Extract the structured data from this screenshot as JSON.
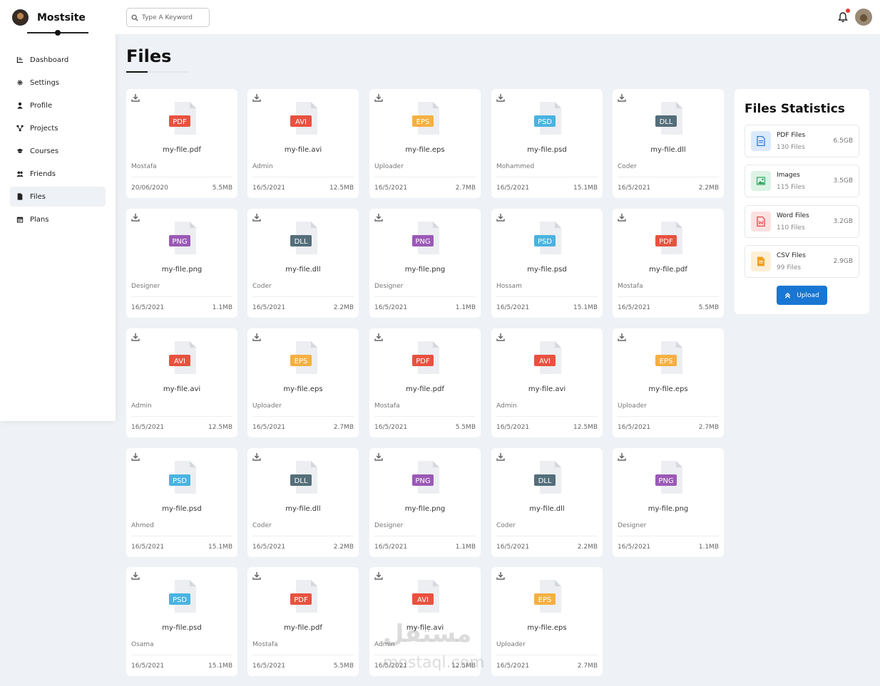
{
  "brand": {
    "name": "Mostsite"
  },
  "nav": [
    {
      "label": "Dashboard",
      "icon": "dashboard-icon"
    },
    {
      "label": "Settings",
      "icon": "gear-icon"
    },
    {
      "label": "Profile",
      "icon": "user-icon"
    },
    {
      "label": "Projects",
      "icon": "projects-icon"
    },
    {
      "label": "Courses",
      "icon": "graduation-cap-icon"
    },
    {
      "label": "Friends",
      "icon": "users-icon"
    },
    {
      "label": "Files",
      "icon": "file-icon",
      "active": true
    },
    {
      "label": "Plans",
      "icon": "calendar-icon"
    }
  ],
  "search": {
    "placeholder": "Type A Keyword"
  },
  "page": {
    "title": "Files"
  },
  "files": [
    {
      "type": "PDF",
      "name": "my-file.pdf",
      "owner": "Mostafa",
      "date": "20/06/2020",
      "size": "5.5MB"
    },
    {
      "type": "AVI",
      "name": "my-file.avi",
      "owner": "Admin",
      "date": "16/5/2021",
      "size": "12.5MB"
    },
    {
      "type": "EPS",
      "name": "my-file.eps",
      "owner": "Uploader",
      "date": "16/5/2021",
      "size": "2.7MB"
    },
    {
      "type": "PSD",
      "name": "my-file.psd",
      "owner": "Mohammed",
      "date": "16/5/2021",
      "size": "15.1MB"
    },
    {
      "type": "DLL",
      "name": "my-file.dll",
      "owner": "Coder",
      "date": "16/5/2021",
      "size": "2.2MB"
    },
    {
      "type": "PNG",
      "name": "my-file.png",
      "owner": "Designer",
      "date": "16/5/2021",
      "size": "1.1MB"
    },
    {
      "type": "DLL",
      "name": "my-file.dll",
      "owner": "Coder",
      "date": "16/5/2021",
      "size": "2.2MB"
    },
    {
      "type": "PNG",
      "name": "my-file.png",
      "owner": "Designer",
      "date": "16/5/2021",
      "size": "1.1MB"
    },
    {
      "type": "PSD",
      "name": "my-file.psd",
      "owner": "Hossam",
      "date": "16/5/2021",
      "size": "15.1MB"
    },
    {
      "type": "PDF",
      "name": "my-file.pdf",
      "owner": "Mostafa",
      "date": "16/5/2021",
      "size": "5.5MB"
    },
    {
      "type": "AVI",
      "name": "my-file.avi",
      "owner": "Admin",
      "date": "16/5/2021",
      "size": "12.5MB"
    },
    {
      "type": "EPS",
      "name": "my-file.eps",
      "owner": "Uploader",
      "date": "16/5/2021",
      "size": "2.7MB"
    },
    {
      "type": "PDF",
      "name": "my-file.pdf",
      "owner": "Mostafa",
      "date": "16/5/2021",
      "size": "5.5MB"
    },
    {
      "type": "AVI",
      "name": "my-file.avi",
      "owner": "Admin",
      "date": "16/5/2021",
      "size": "12.5MB"
    },
    {
      "type": "EPS",
      "name": "my-file.eps",
      "owner": "Uploader",
      "date": "16/5/2021",
      "size": "2.7MB"
    },
    {
      "type": "PSD",
      "name": "my-file.psd",
      "owner": "Ahmed",
      "date": "16/5/2021",
      "size": "15.1MB"
    },
    {
      "type": "DLL",
      "name": "my-file.dll",
      "owner": "Coder",
      "date": "16/5/2021",
      "size": "2.2MB"
    },
    {
      "type": "PNG",
      "name": "my-file.png",
      "owner": "Designer",
      "date": "16/5/2021",
      "size": "1.1MB"
    },
    {
      "type": "DLL",
      "name": "my-file.dll",
      "owner": "Coder",
      "date": "16/5/2021",
      "size": "2.2MB"
    },
    {
      "type": "PNG",
      "name": "my-file.png",
      "owner": "Designer",
      "date": "16/5/2021",
      "size": "1.1MB"
    },
    {
      "type": "PSD",
      "name": "my-file.psd",
      "owner": "Osama",
      "date": "16/5/2021",
      "size": "15.1MB"
    },
    {
      "type": "PDF",
      "name": "my-file.pdf",
      "owner": "Mostafa",
      "date": "16/5/2021",
      "size": "5.5MB"
    },
    {
      "type": "AVI",
      "name": "my-file.avi",
      "owner": "Admin",
      "date": "16/5/2021",
      "size": "12.5MB"
    },
    {
      "type": "EPS",
      "name": "my-file.eps",
      "owner": "Uploader",
      "date": "16/5/2021",
      "size": "2.7MB"
    }
  ],
  "typeColors": {
    "PDF": "#e8523f",
    "AVI": "#e8523f",
    "EPS": "#f5b041",
    "PSD": "#4ab3e0",
    "DLL": "#546e7a",
    "PNG": "#9b59b6"
  },
  "stats": {
    "title": "Files Statistics",
    "items": [
      {
        "name": "PDF Files",
        "count": "130 Files",
        "size": "6.5GB",
        "icon": "pdf-icon",
        "color": "#1976d2",
        "bg": "#dbe9fb"
      },
      {
        "name": "Images",
        "count": "115 Files",
        "size": "3.5GB",
        "icon": "image-icon",
        "color": "#2e9e5b",
        "bg": "#dcf3e5"
      },
      {
        "name": "Word Files",
        "count": "110 Files",
        "size": "3.2GB",
        "icon": "word-icon",
        "color": "#e53935",
        "bg": "#fbe1e1"
      },
      {
        "name": "CSV Files",
        "count": "99 Files",
        "size": "2.9GB",
        "icon": "csv-icon",
        "color": "#f0a020",
        "bg": "#fdefd6"
      }
    ],
    "upload_label": "Upload"
  },
  "watermark": {
    "arabic": "مستقل",
    "latin": "mostaql.com"
  }
}
